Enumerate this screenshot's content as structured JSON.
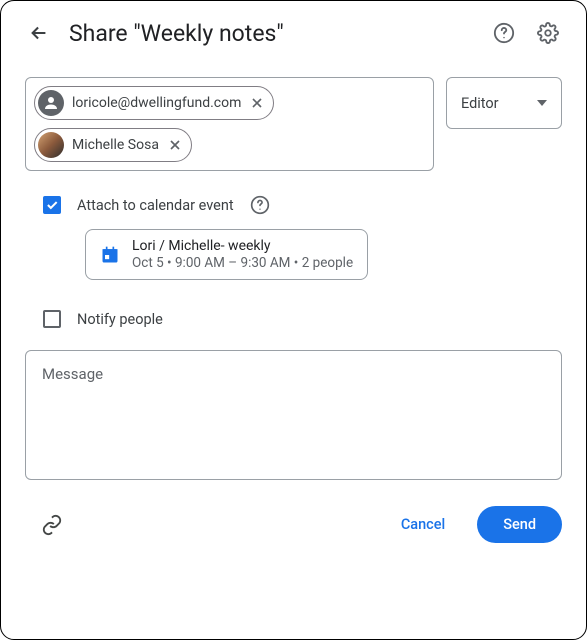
{
  "header": {
    "title": "Share \"Weekly notes\""
  },
  "recipients": [
    {
      "label": "loricole@dwellingfund.com",
      "avatar_type": "generic"
    },
    {
      "label": "Michelle Sosa",
      "avatar_type": "photo"
    }
  ],
  "role": {
    "label": "Editor"
  },
  "attach": {
    "label": "Attach to calendar event",
    "checked": true
  },
  "event": {
    "title": "Lori / Michelle- weekly",
    "subtitle": "Oct 5 • 9:00 AM – 9:30 AM • 2 people"
  },
  "notify": {
    "label": "Notify people",
    "checked": false
  },
  "message": {
    "placeholder": "Message"
  },
  "footer": {
    "cancel": "Cancel",
    "send": "Send"
  }
}
